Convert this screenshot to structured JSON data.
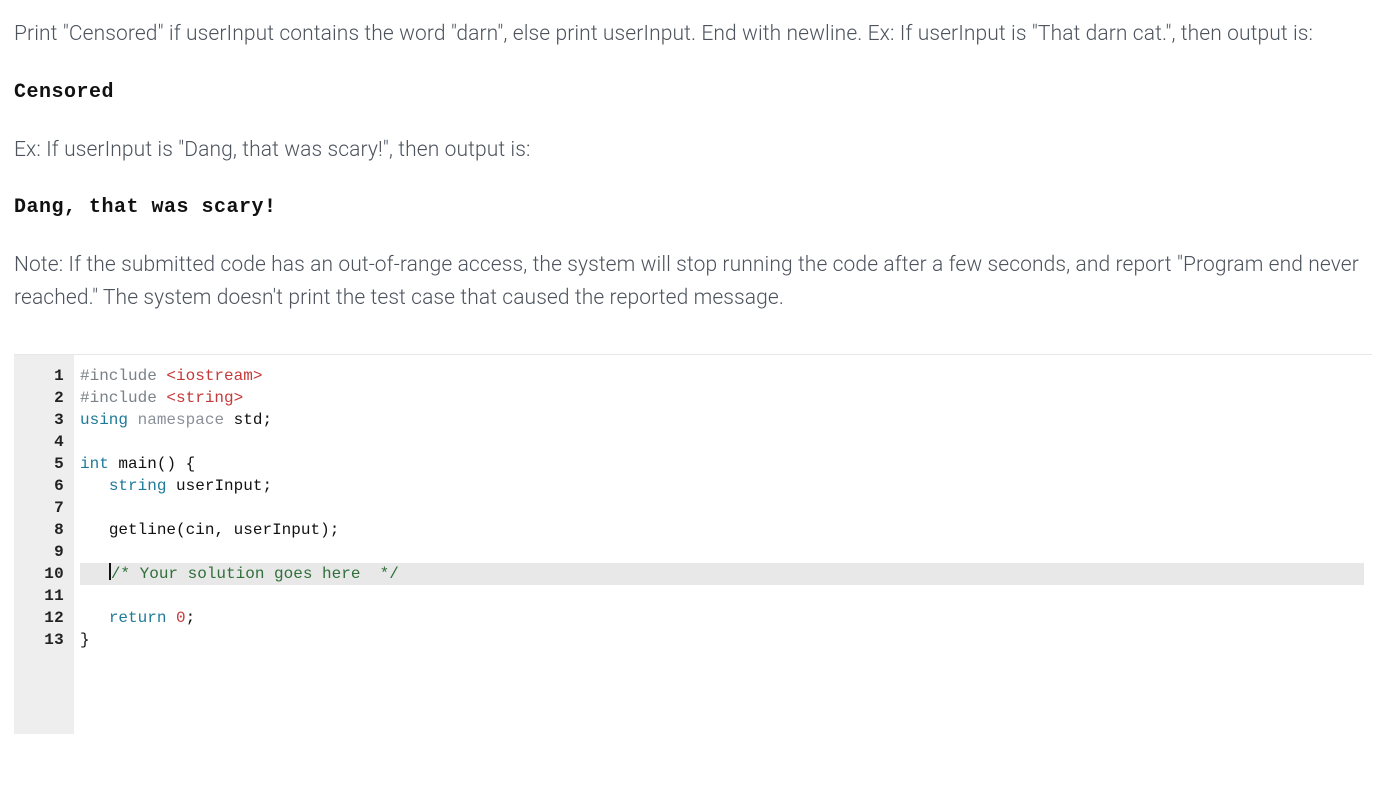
{
  "problem": {
    "p1": "Print \"Censored\" if userInput contains the word \"darn\", else print userInput. End with newline. Ex: If userInput is \"That darn cat.\", then output is:",
    "sample1": "Censored",
    "p2": "Ex: If userInput is \"Dang, that was scary!\", then output is:",
    "sample2": "Dang, that was scary!",
    "note": "Note: If the submitted code has an out-of-range access, the system will stop running the code after a few seconds, and report \"Program end never reached.\" The system doesn't print the test case that caused the reported message."
  },
  "editor": {
    "active_line": 10,
    "tokens": {
      "include": "#include",
      "hdr_iostream": "<iostream>",
      "hdr_string": "<string>",
      "kw_using": "using",
      "kw_namespace": "namespace",
      "id_std": "std",
      "kw_int": "int",
      "id_main": "main",
      "paren_open": "(",
      "paren_close": ")",
      "brace_open": "{",
      "brace_close": "}",
      "type_string": "string",
      "id_userInput": "userInput",
      "semi": ";",
      "id_getline": "getline",
      "id_cin": "cin",
      "comma": ",",
      "comment_placeholder": "/* Your solution goes here  */",
      "kw_return": "return",
      "num_zero": "0"
    },
    "line_numbers": [
      "1",
      "2",
      "3",
      "4",
      "5",
      "6",
      "7",
      "8",
      "9",
      "10",
      "11",
      "12",
      "13"
    ]
  }
}
